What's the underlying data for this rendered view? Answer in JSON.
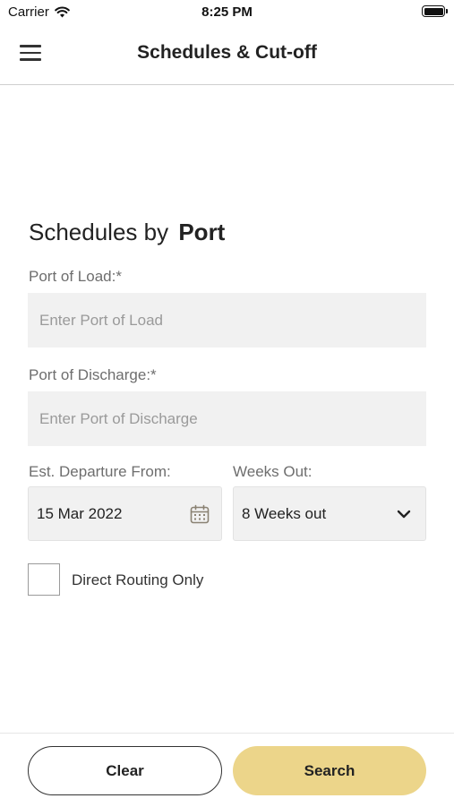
{
  "status_bar": {
    "carrier": "Carrier",
    "time": "8:25 PM"
  },
  "nav": {
    "title": "Schedules & Cut-off"
  },
  "section": {
    "title_prefix": "Schedules by",
    "title_bold": "Port"
  },
  "port_of_load": {
    "label": "Port of Load:*",
    "placeholder": "Enter Port of Load",
    "value": ""
  },
  "port_of_discharge": {
    "label": "Port of Discharge:*",
    "placeholder": "Enter Port of Discharge",
    "value": ""
  },
  "departure": {
    "label": "Est. Departure From:",
    "value": "15 Mar 2022"
  },
  "weeks_out": {
    "label": "Weeks Out:",
    "value": "8 Weeks out"
  },
  "direct_routing": {
    "label": "Direct Routing Only",
    "checked": false
  },
  "actions": {
    "clear_label": "Clear",
    "search_label": "Search"
  },
  "colors": {
    "accent": "#ECD58A",
    "field_bg": "#F1F1F1",
    "label": "#6E6E6E"
  },
  "icons": [
    "wifi-icon",
    "battery-icon",
    "hamburger-menu-icon",
    "calendar-icon",
    "chevron-down-icon"
  ]
}
